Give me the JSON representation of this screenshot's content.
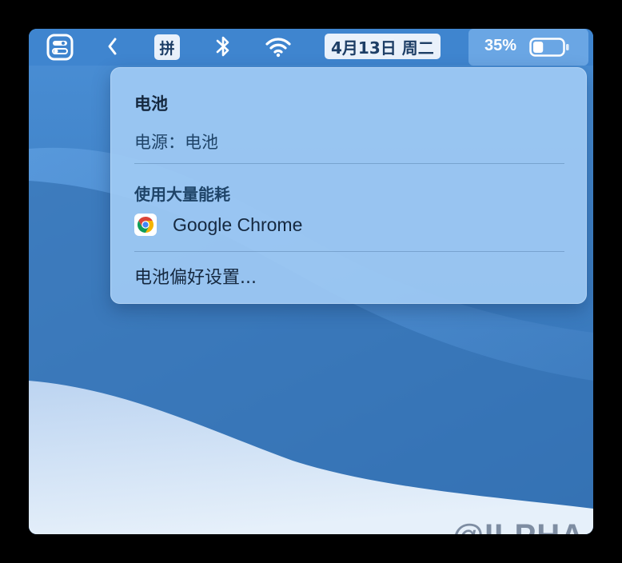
{
  "menubar": {
    "control_center_icon": "control-center-icon",
    "chevron_icon": "chevron-left-icon",
    "input_method": "拼",
    "bluetooth_icon": "bluetooth-icon",
    "wifi_icon": "wifi-icon",
    "date": "4月13日 周二",
    "battery_percent": "35%",
    "battery_level": 0.35,
    "battery_icon": "battery-icon"
  },
  "battery_menu": {
    "title": "电池",
    "power_source": "电源：电池",
    "section_heading": "使用大量能耗",
    "apps": [
      {
        "name": "Google Chrome",
        "icon": "chrome-icon"
      }
    ],
    "preferences": "电池偏好设置..."
  },
  "watermark": "@ILPHA",
  "colors": {
    "menubar": "#3f85cf",
    "popup": "#a0caf4",
    "wallpaper_dark": "#3574b5",
    "wallpaper_light": "#dce9f7"
  }
}
